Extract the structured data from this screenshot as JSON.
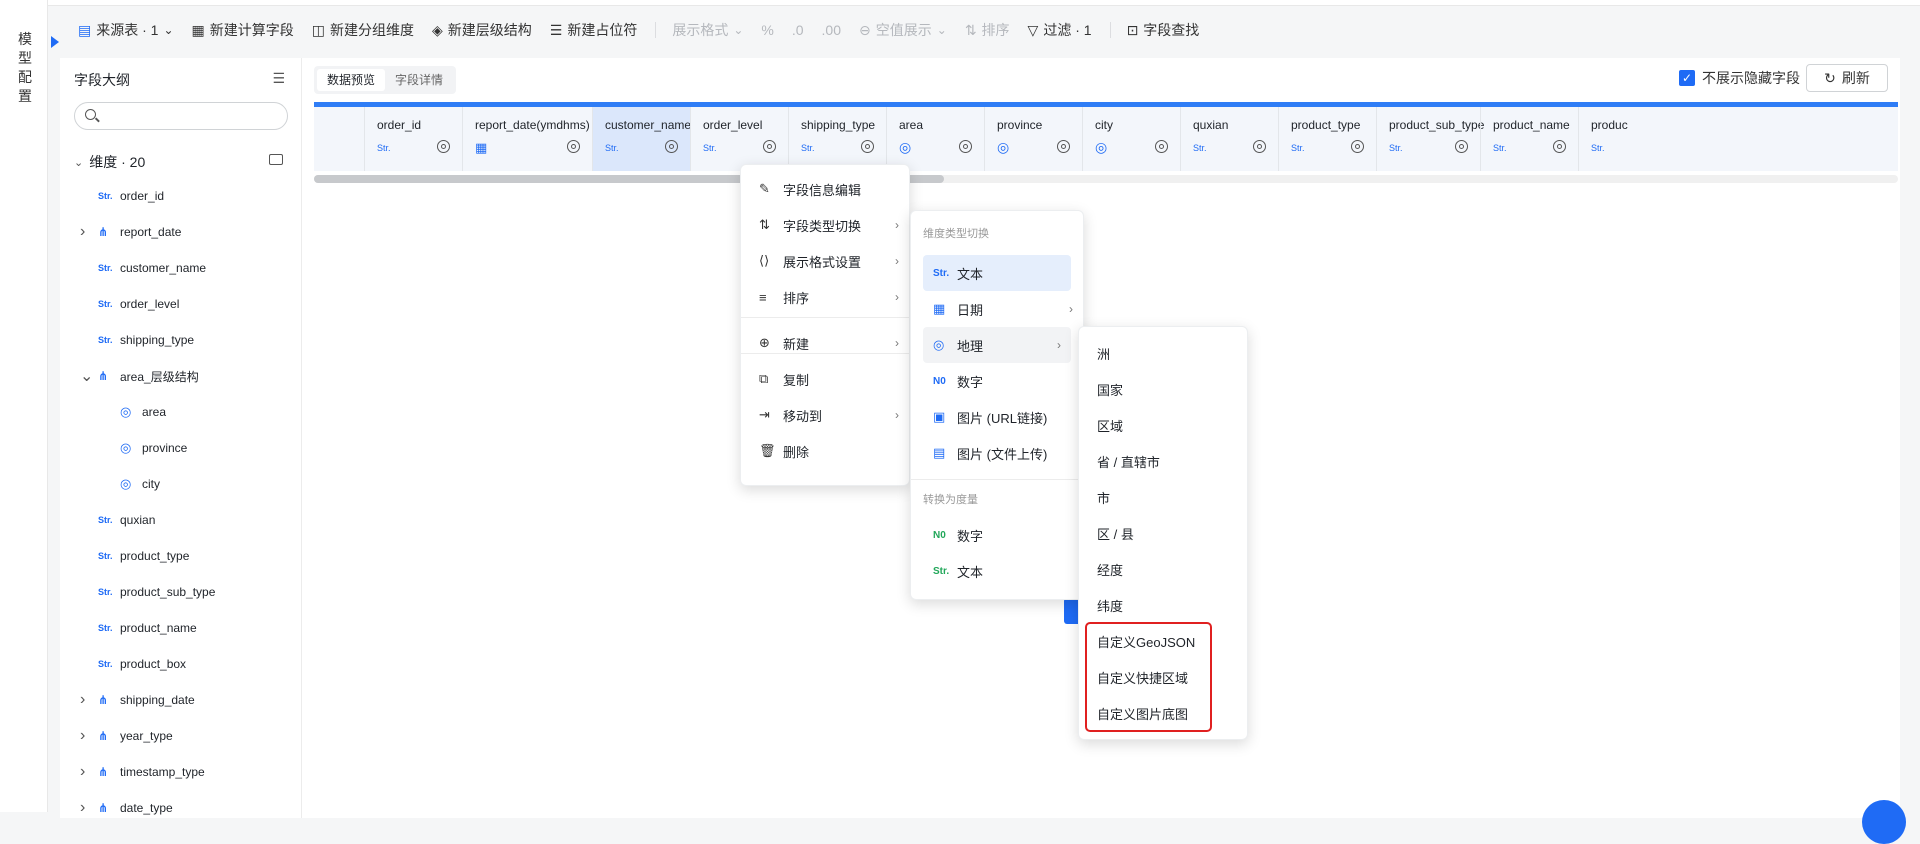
{
  "left_rail": {
    "label": [
      "模",
      "型",
      "配",
      "置"
    ]
  },
  "toolbar": {
    "items": [
      {
        "icon": "table-icon",
        "label": "来源表 · 1",
        "dropdown": true,
        "disabled": false
      },
      {
        "icon": "calc-field-icon",
        "label": "新建计算字段",
        "disabled": false
      },
      {
        "icon": "group-dim-icon",
        "label": "新建分组维度",
        "disabled": false
      },
      {
        "icon": "hierarchy-icon",
        "label": "新建层级结构",
        "disabled": false
      },
      {
        "icon": "placeholder-icon",
        "label": "新建占位符",
        "disabled": false
      },
      {
        "icon": "",
        "label": "展示格式",
        "dropdown": true,
        "disabled": true
      },
      {
        "icon": "percent-icon",
        "label": "%",
        "disabled": true
      },
      {
        "icon": "decimal-decrease-icon",
        "label": ".0",
        "disabled": true
      },
      {
        "icon": "decimal-increase-icon",
        "label": ".00",
        "disabled": true
      },
      {
        "icon": "null-display-icon",
        "label": "空值展示",
        "dropdown": true,
        "disabled": true
      },
      {
        "icon": "sort-icon",
        "label": "排序",
        "disabled": true
      },
      {
        "icon": "filter-icon",
        "label": "过滤 · 1",
        "disabled": false
      },
      {
        "icon": "field-search-icon",
        "label": "字段查找",
        "disabled": false
      }
    ]
  },
  "outline": {
    "title": "字段大纲",
    "group_label": "维度 · 20",
    "items": [
      {
        "name": "order_id",
        "type": "Str",
        "indent": 0,
        "arrow": ""
      },
      {
        "name": "report_date",
        "type": "hier",
        "indent": 0,
        "arrow": "›"
      },
      {
        "name": "customer_name",
        "type": "Str",
        "indent": 0,
        "arrow": ""
      },
      {
        "name": "order_level",
        "type": "Str",
        "indent": 0,
        "arrow": ""
      },
      {
        "name": "shipping_type",
        "type": "Str",
        "indent": 0,
        "arrow": ""
      },
      {
        "name": "area_层级结构",
        "type": "hier",
        "indent": 0,
        "arrow": "⌄"
      },
      {
        "name": "area",
        "type": "geo",
        "indent": 1,
        "arrow": ""
      },
      {
        "name": "province",
        "type": "geo",
        "indent": 1,
        "arrow": ""
      },
      {
        "name": "city",
        "type": "geo",
        "indent": 1,
        "arrow": ""
      },
      {
        "name": "quxian",
        "type": "Str",
        "indent": 0,
        "arrow": ""
      },
      {
        "name": "product_type",
        "type": "Str",
        "indent": 0,
        "arrow": ""
      },
      {
        "name": "product_sub_type",
        "type": "Str",
        "indent": 0,
        "arrow": ""
      },
      {
        "name": "product_name",
        "type": "Str",
        "indent": 0,
        "arrow": ""
      },
      {
        "name": "product_box",
        "type": "Str",
        "indent": 0,
        "arrow": ""
      },
      {
        "name": "shipping_date",
        "type": "hier",
        "indent": 0,
        "arrow": "›"
      },
      {
        "name": "year_type",
        "type": "hier",
        "indent": 0,
        "arrow": "›"
      },
      {
        "name": "timestamp_type",
        "type": "hier",
        "indent": 0,
        "arrow": "›"
      },
      {
        "name": "date_type",
        "type": "hier",
        "indent": 0,
        "arrow": "›"
      }
    ]
  },
  "panel": {
    "tabs": [
      "数据预览",
      "字段详情"
    ],
    "hide_hidden_label": "不展示隐藏字段",
    "refresh_label": "刷新"
  },
  "columns": [
    {
      "name": "order_id",
      "type": "Str"
    },
    {
      "name": "report_date(ymdhms)",
      "type": "date"
    },
    {
      "name": "customer_name",
      "type": "Str",
      "selected": true
    },
    {
      "name": "order_level",
      "type": "Str"
    },
    {
      "name": "shipping_type",
      "type": "Str"
    },
    {
      "name": "area",
      "type": "geo"
    },
    {
      "name": "province",
      "type": "geo"
    },
    {
      "name": "city",
      "type": "geo"
    },
    {
      "name": "quxian",
      "type": "Str"
    },
    {
      "name": "product_type",
      "type": "Str"
    },
    {
      "name": "product_sub_type",
      "type": "Str"
    },
    {
      "name": "product_name",
      "type": "Str"
    },
    {
      "name": "produc",
      "type": "Str"
    }
  ],
  "context_menu": {
    "items": [
      {
        "icon": "✎",
        "label": "字段信息编辑",
        "sub": false
      },
      {
        "icon": "⇅",
        "label": "字段类型切换",
        "sub": true
      },
      {
        "icon": "⟨⟩",
        "label": "展示格式设置",
        "sub": true
      },
      {
        "icon": "≡",
        "label": "排序",
        "sub": true
      },
      {
        "icon": "⊕",
        "label": "新建",
        "sub": true
      },
      {
        "icon": "⧉",
        "label": "复制",
        "sub": false
      },
      {
        "icon": "⇥",
        "label": "移动到",
        "sub": true
      },
      {
        "icon": "🗑",
        "label": "删除",
        "sub": false
      }
    ]
  },
  "type_submenu": {
    "dim_header": "维度类型切换",
    "dim_items": [
      {
        "icon": "Str.",
        "label": "文本",
        "sub": false,
        "state": "sel"
      },
      {
        "icon": "▦",
        "label": "日期",
        "sub": true,
        "state": ""
      },
      {
        "icon": "◎",
        "label": "地理",
        "sub": true,
        "state": "hov"
      },
      {
        "icon": "N0",
        "label": "数字",
        "sub": false,
        "state": ""
      },
      {
        "icon": "▣",
        "label": "图片 (URL链接)",
        "sub": false,
        "state": ""
      },
      {
        "icon": "▤",
        "label": "图片 (文件上传)",
        "sub": false,
        "state": ""
      }
    ],
    "measure_header": "转换为度量",
    "measure_items": [
      {
        "icon": "N0",
        "label": "数字"
      },
      {
        "icon": "Str.",
        "label": "文本"
      }
    ]
  },
  "geo_submenu": {
    "items": [
      "洲",
      "国家",
      "区域",
      "省 / 直辖市",
      "市",
      "区 / 县",
      "经度",
      "纬度",
      "自定义GeoJSON",
      "自定义快捷区域",
      "自定义图片底图"
    ]
  },
  "colors": {
    "accent": "#1f6bf5",
    "highlight_box": "#e02020"
  }
}
